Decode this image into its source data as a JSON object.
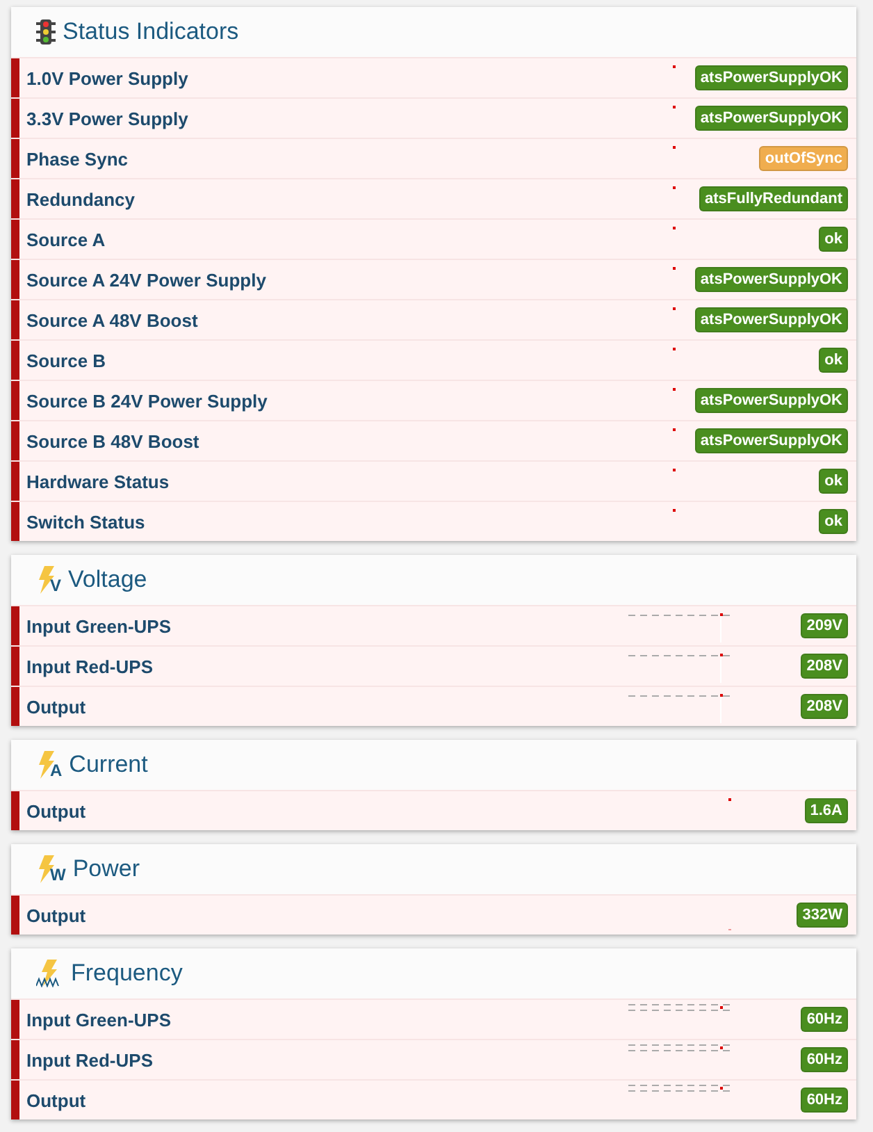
{
  "panels": [
    {
      "title": "Status Indicators",
      "kind": "traffic-light",
      "rows": [
        {
          "label": "1.0V Power Supply",
          "value": "atsPowerSupplyOK",
          "color": "#4a8e1f",
          "kind": "dot"
        },
        {
          "label": "3.3V Power Supply",
          "value": "atsPowerSupplyOK",
          "color": "#4a8e1f",
          "kind": "dot"
        },
        {
          "label": "Phase Sync",
          "value": "outOfSync",
          "color": "#f0ad4e",
          "kind": "dot"
        },
        {
          "label": "Redundancy",
          "value": "atsFullyRedundant",
          "color": "#4a8e1f",
          "kind": "dot"
        },
        {
          "label": "Source A",
          "value": "ok",
          "color": "#4a8e1f",
          "kind": "dot"
        },
        {
          "label": "Source A 24V Power Supply",
          "value": "atsPowerSupplyOK",
          "color": "#4a8e1f",
          "kind": "dot"
        },
        {
          "label": "Source A 48V Boost",
          "value": "atsPowerSupplyOK",
          "color": "#4a8e1f",
          "kind": "dot"
        },
        {
          "label": "Source B",
          "value": "ok",
          "color": "#4a8e1f",
          "kind": "dot"
        },
        {
          "label": "Source B 24V Power Supply",
          "value": "atsPowerSupplyOK",
          "color": "#4a8e1f",
          "kind": "dot"
        },
        {
          "label": "Source B 48V Boost",
          "value": "atsPowerSupplyOK",
          "color": "#4a8e1f",
          "kind": "dot"
        },
        {
          "label": "Hardware Status",
          "value": "ok",
          "color": "#4a8e1f",
          "kind": "dot"
        },
        {
          "label": "Switch Status",
          "value": "ok",
          "color": "#4a8e1f",
          "kind": "dot"
        }
      ]
    },
    {
      "title": "Voltage",
      "kind": "bolt-letter",
      "icon_letter": "V",
      "rows": [
        {
          "label": "Input Green-UPS",
          "value": "209V",
          "color": "#4a8e1f",
          "kind": "dash"
        },
        {
          "label": "Input Red-UPS",
          "value": "208V",
          "color": "#4a8e1f",
          "kind": "dash"
        },
        {
          "label": "Output",
          "value": "208V",
          "color": "#4a8e1f",
          "kind": "dash"
        }
      ]
    },
    {
      "title": "Current",
      "kind": "bolt-letter",
      "icon_letter": "A",
      "rows": [
        {
          "label": "Output",
          "value": "1.6A",
          "color": "#4a8e1f",
          "kind": "dot"
        }
      ]
    },
    {
      "title": "Power",
      "kind": "bolt-letter",
      "icon_letter": "W",
      "rows": [
        {
          "label": "Output",
          "value": "332W",
          "color": "#4a8e1f",
          "kind": "low-dot"
        }
      ]
    },
    {
      "title": "Frequency",
      "kind": "bolt-wave",
      "rows": [
        {
          "label": "Input Green-UPS",
          "value": "60Hz",
          "color": "#4a8e1f",
          "kind": "double-dash"
        },
        {
          "label": "Input Red-UPS",
          "value": "60Hz",
          "color": "#4a8e1f",
          "kind": "double-dash"
        },
        {
          "label": "Output",
          "value": "60Hz",
          "color": "#4a8e1f",
          "kind": "double-dash"
        }
      ]
    }
  ]
}
